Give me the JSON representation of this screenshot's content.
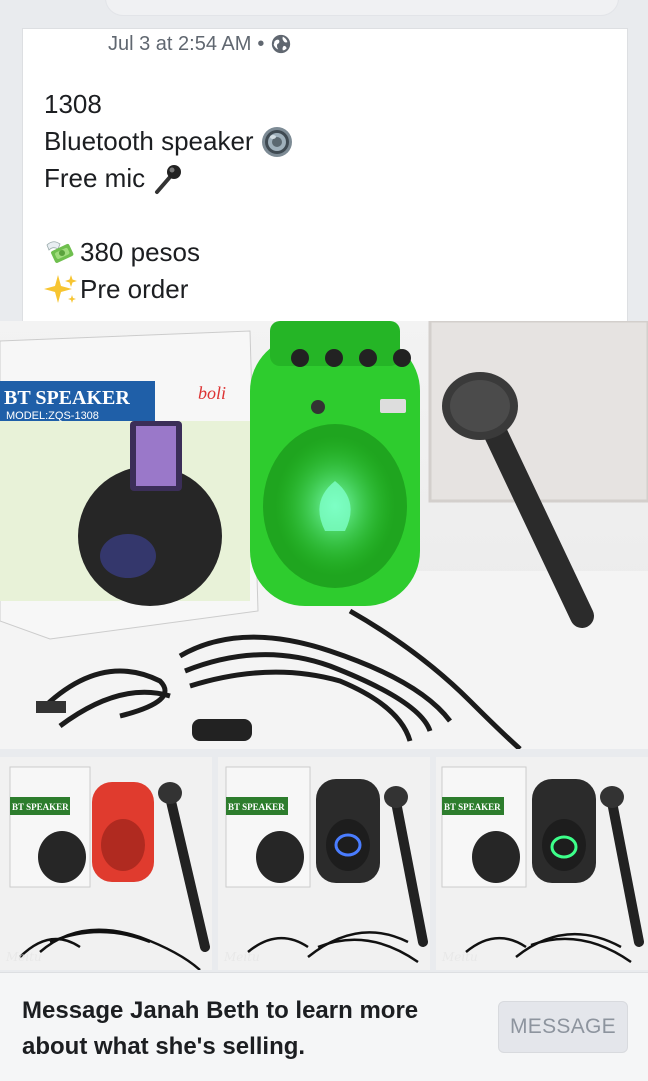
{
  "post": {
    "timestamp": "Jul 3 at 2:54 AM",
    "separator": "•",
    "privacy_icon": "globe-icon",
    "lines": {
      "code": "1308",
      "product": "Bluetooth speaker",
      "extra": "Free mic",
      "price": "380 pesos",
      "status": "Pre order"
    },
    "emojis": {
      "speaker": "speaker-icon",
      "mic": "microphone-icon",
      "money": "money-with-wings-icon",
      "sparkles": "sparkles-icon"
    }
  },
  "photos": {
    "hero": {
      "box_title": "BT SPEAKER",
      "box_model": "MODEL:ZQS-1308",
      "brand": "boli",
      "speaker_color": "#2ecc2e"
    },
    "thumbnails": [
      {
        "speaker_color": "#e03b2e",
        "watermark": "Meitu",
        "box_title": "BT SPEAKER"
      },
      {
        "speaker_color": "#2b2b2b",
        "watermark": "Meitu",
        "box_title": "BT SPEAKER"
      },
      {
        "speaker_color": "#2b2b2b",
        "watermark": "Meitu",
        "box_title": "BT SPEAKER"
      }
    ]
  },
  "cta": {
    "text": "Message Janah Beth to learn more about what she's selling.",
    "button_label": "MESSAGE"
  },
  "colors": {
    "background": "#e9ebee",
    "text_primary": "#1c1e21",
    "text_secondary": "#606770",
    "button_bg": "#e4e6eb",
    "button_text": "#8d949e"
  }
}
